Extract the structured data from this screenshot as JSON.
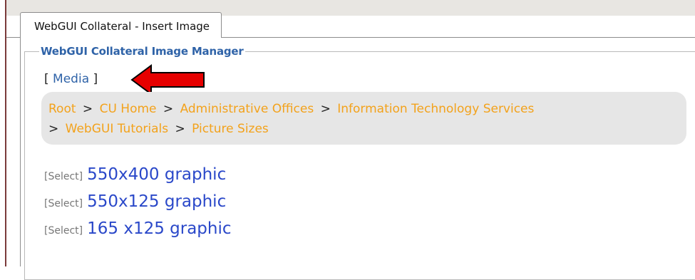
{
  "tab": {
    "title": "WebGUI Collateral - Insert Image"
  },
  "manager": {
    "legend": "WebGUI Collateral Image Manager",
    "media_open": "[ ",
    "media_label": "Media",
    "media_close": " ]"
  },
  "breadcrumb": {
    "separator": ">",
    "items": [
      "Root",
      "CU Home",
      "Administrative Offices",
      "Information Technology Services",
      "WebGUI Tutorials",
      "Picture Sizes"
    ]
  },
  "files": [
    {
      "select": "[Select]",
      "name": "550x400 graphic"
    },
    {
      "select": "[Select]",
      "name": "550x125 graphic"
    },
    {
      "select": "[Select]",
      "name": "165 x125 graphic"
    }
  ],
  "colors": {
    "accent": "#2f63a8",
    "breadcrumb_link": "#f3a21b",
    "file_link": "#2a48c9",
    "arrow": "#e60000"
  },
  "annotation": {
    "icon": "red-arrow-icon"
  }
}
